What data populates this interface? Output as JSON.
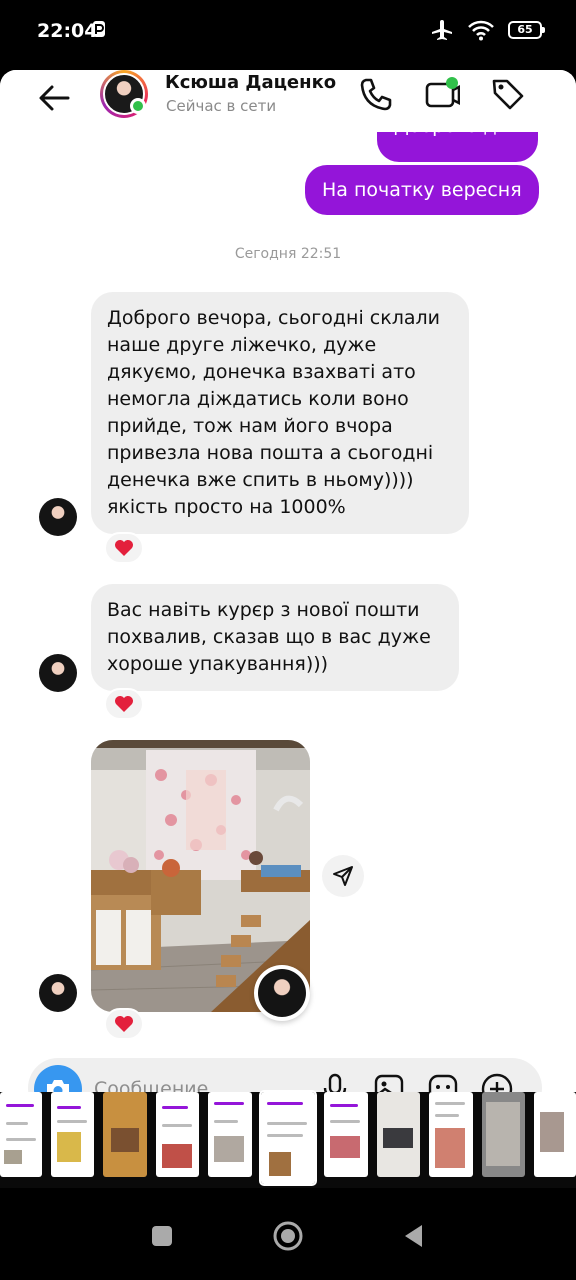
{
  "status_bar": {
    "time": "22:04",
    "battery": "65"
  },
  "header": {
    "contact_name": "Ксюша Даценко",
    "contact_status": "Сейчас в сети"
  },
  "messages": {
    "outgoing_1": "Доброго дня",
    "outgoing_2": "На початку вересня",
    "timestamp": "Сегодня 22:51",
    "incoming_1": "Доброго вечора, сьогодні склали наше друге ліжечко, дуже дякуємо, донечка взахваті ато немогла діждатись коли воно прийде, тож нам його вчора привезла нова пошта а сьогодні денечка вже спить в ньому)))) якість просто на 1000%",
    "incoming_2": "Вас навіть курєр з нової пошти похвалив, сказав що в вас дуже хороше упакування)))",
    "reaction": "❤️"
  },
  "composer": {
    "placeholder": "Сообщение..."
  },
  "colors": {
    "outgoing_bubble": "#9415d9",
    "incoming_bubble": "#eeeeee",
    "camera_button": "#3797f0",
    "online": "#31c04a"
  },
  "icons": [
    "back-arrow-icon",
    "phone-icon",
    "video-call-icon",
    "tag-icon",
    "share-icon",
    "camera-icon",
    "mic-icon",
    "gallery-icon",
    "sticker-icon",
    "plus-icon",
    "heart-icon"
  ]
}
